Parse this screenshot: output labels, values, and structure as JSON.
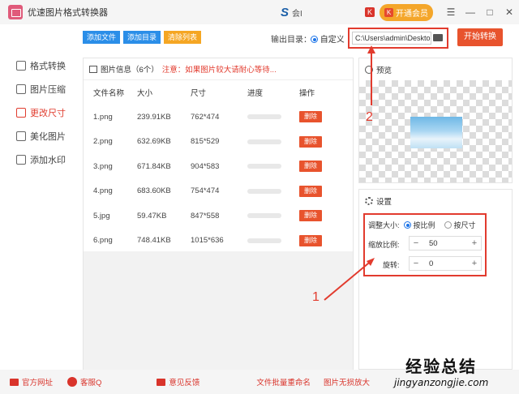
{
  "window": {
    "title": "优速图片格式转换器",
    "user": "会I",
    "vip_label": "开通会员",
    "k_badge": "K"
  },
  "sidebar": {
    "items": [
      {
        "label": "格式转换"
      },
      {
        "label": "图片压缩"
      },
      {
        "label": "更改尺寸"
      },
      {
        "label": "美化图片"
      },
      {
        "label": "添加水印"
      }
    ]
  },
  "toolbar": {
    "add_file": "添加文件",
    "add_dir": "添加目录",
    "clear_list": "清除列表"
  },
  "output": {
    "label": "输出目录：",
    "custom_label": "自定义",
    "path": "C:\\Users\\admin\\Deskto",
    "start_label": "开始转换"
  },
  "file_panel": {
    "header": "图片信息（6个）",
    "notice": "注意：如果图片较大请耐心等待...",
    "columns": [
      "文件名称",
      "大小",
      "尺寸",
      "进度",
      "操作"
    ],
    "delete_label": "删除",
    "rows": [
      {
        "name": "1.png",
        "size": "239.91KB",
        "dim": "762*474"
      },
      {
        "name": "2.png",
        "size": "632.69KB",
        "dim": "815*529"
      },
      {
        "name": "3.png",
        "size": "671.84KB",
        "dim": "904*583"
      },
      {
        "name": "4.png",
        "size": "683.60KB",
        "dim": "754*474"
      },
      {
        "name": "5.jpg",
        "size": "59.47KB",
        "dim": "847*558"
      },
      {
        "name": "6.png",
        "size": "748.41KB",
        "dim": "1015*636"
      }
    ]
  },
  "preview": {
    "label": "预览"
  },
  "settings": {
    "label": "设置",
    "resize_label": "调整大小:",
    "by_ratio": "按比例",
    "by_size": "按尺寸",
    "scale_label": "缩放比例:",
    "scale_value": "50",
    "rotate_label": "旋转:",
    "rotate_value": "0"
  },
  "annotations": {
    "one": "1",
    "two": "2"
  },
  "footer": {
    "website": "官方网址",
    "service": "客服Q",
    "feedback": "意见反馈",
    "batch_rename": "文件批量重命名",
    "lossless": "图片无损放大"
  },
  "watermark": {
    "title": "经验总结",
    "url": "jingyanzongjie.com"
  }
}
